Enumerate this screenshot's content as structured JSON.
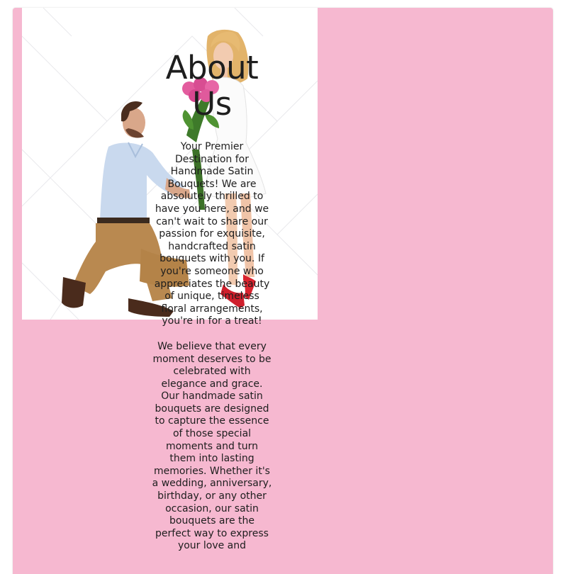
{
  "theme": {
    "panel_color": "#f6b8d0",
    "text_color": "#1e1e1e"
  },
  "about": {
    "title": "About Us",
    "paragraph1": "Your Premier Destination for Handmade Satin Bouquets! We are absolutely thrilled to have you here, and we can't wait to share our passion for exquisite, handcrafted satin bouquets with you. If you're someone who appreciates the beauty of unique, timeless floral arrangements, you're in for a treat!",
    "paragraph2": "We believe that every moment deserves to be celebrated with elegance and grace. Our handmade satin bouquets are designed to capture the essence of those special moments and turn them into lasting memories. Whether it's a wedding, anniversary, birthday, or any other occasion, our satin bouquets are the perfect way to express your love and"
  },
  "image": {
    "icon": "couple-proposal-photo"
  }
}
